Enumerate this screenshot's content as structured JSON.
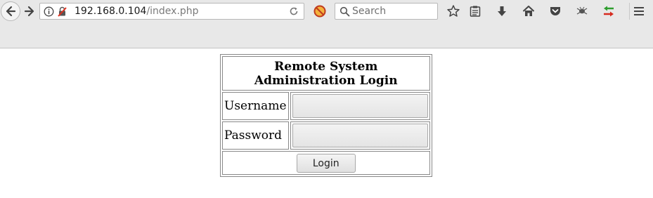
{
  "browser": {
    "url_host": "192.168.0.104",
    "url_path": "/index.php",
    "search_placeholder": "Search",
    "icons": {
      "back": "back-arrow-icon",
      "forward": "forward-arrow-icon",
      "info": "info-icon",
      "insecure": "insecure-lock-icon",
      "reload": "reload-icon",
      "addon": "blocked-addon-icon",
      "search": "search-icon",
      "bookmark": "star-icon",
      "reading_list": "reading-list-icon",
      "downloads": "download-icon",
      "home": "home-icon",
      "pocket": "pocket-icon",
      "extension": "bug-extension-icon",
      "proxy": "proxy-arrows-icon",
      "menu": "hamburger-menu-icon"
    }
  },
  "login": {
    "title": "Remote System Administration Login",
    "username_label": "Username",
    "password_label": "Password",
    "username_value": "",
    "password_value": "",
    "button_label": "Login"
  }
}
